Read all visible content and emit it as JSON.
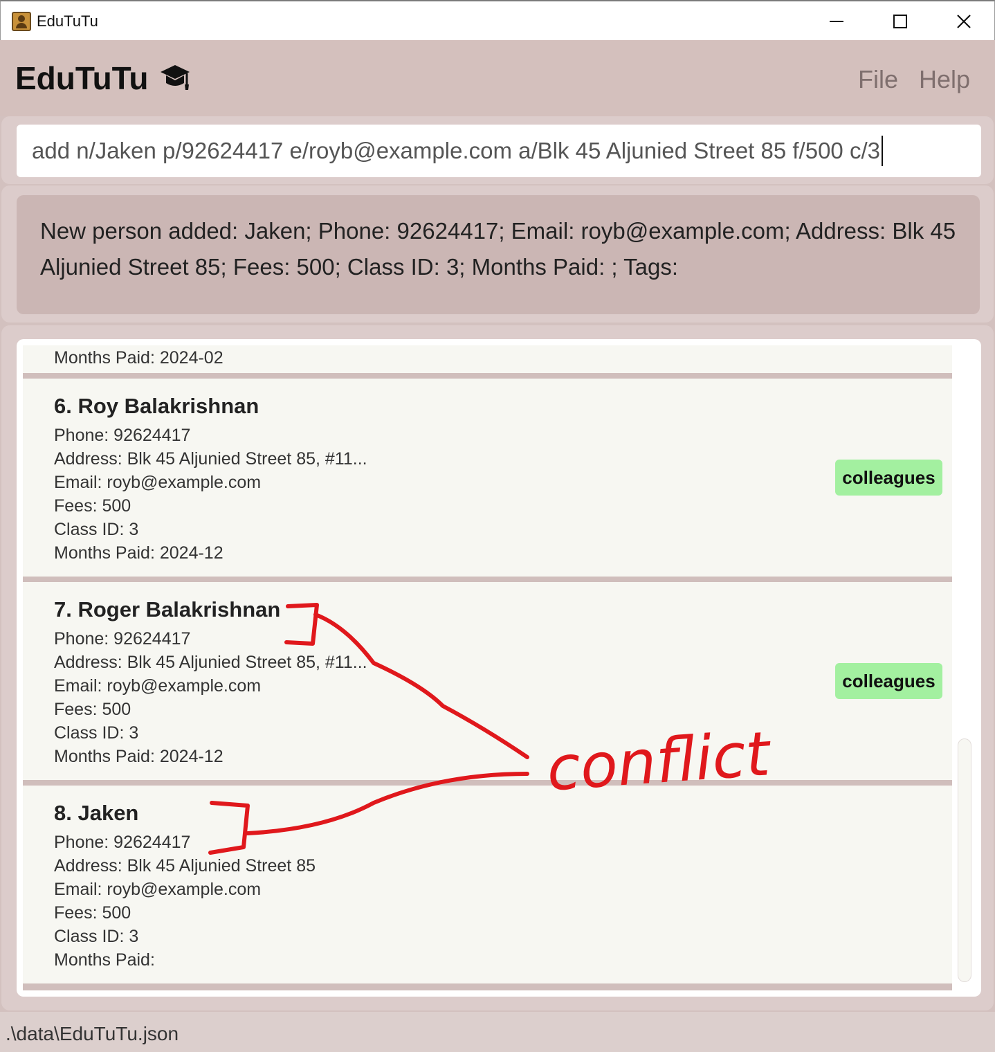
{
  "window": {
    "title": "EduTuTu",
    "minimize": "minimize",
    "maximize": "maximize",
    "close": "close"
  },
  "header": {
    "brand": "EduTuTu",
    "menu": [
      "File",
      "Help"
    ]
  },
  "command": {
    "value": "add n/Jaken p/92624417 e/royb@example.com a/Blk 45 Aljunied Street 85 f/500 c/3"
  },
  "result": {
    "text": "New person added: Jaken; Phone: 92624417; Email: royb@example.com; Address: Blk 45 Aljunied Street 85; Fees: 500; Class ID: 3; Months Paid: ; Tags:"
  },
  "persons": [
    {
      "partial": true,
      "months_paid_label": "Months Paid:  2024-02"
    },
    {
      "name": "6. Roy Balakrishnan",
      "phone": "Phone:  92624417",
      "address": "Address:  Blk 45 Aljunied Street 85, #11...",
      "email": "Email:  royb@example.com",
      "fees": "Fees:  500",
      "class_id": "Class ID:  3",
      "months_paid": "Months Paid:  2024-12",
      "tag": "colleagues"
    },
    {
      "name": "7. Roger Balakrishnan",
      "phone": "Phone:  92624417",
      "address": "Address:  Blk 45 Aljunied Street 85, #11...",
      "email": "Email:  royb@example.com",
      "fees": "Fees:  500",
      "class_id": "Class ID:  3",
      "months_paid": "Months Paid:  2024-12",
      "tag": "colleagues"
    },
    {
      "name": "8. Jaken",
      "phone": "Phone:  92624417",
      "address": "Address:  Blk 45 Aljunied Street 85",
      "email": "Email:  royb@example.com",
      "fees": "Fees:  500",
      "class_id": "Class ID:  3",
      "months_paid": "Months Paid:",
      "tag": ""
    }
  ],
  "annotation": {
    "text": "conflict",
    "color": "#e0181c"
  },
  "status": {
    "path": ".\\data\\EduTuTu.json"
  },
  "colors": {
    "header_bg": "#d4c0bd",
    "card_bg": "#f7f7f2",
    "tag_bg": "#a3f0a0",
    "result_bg": "#cbb6b4"
  }
}
